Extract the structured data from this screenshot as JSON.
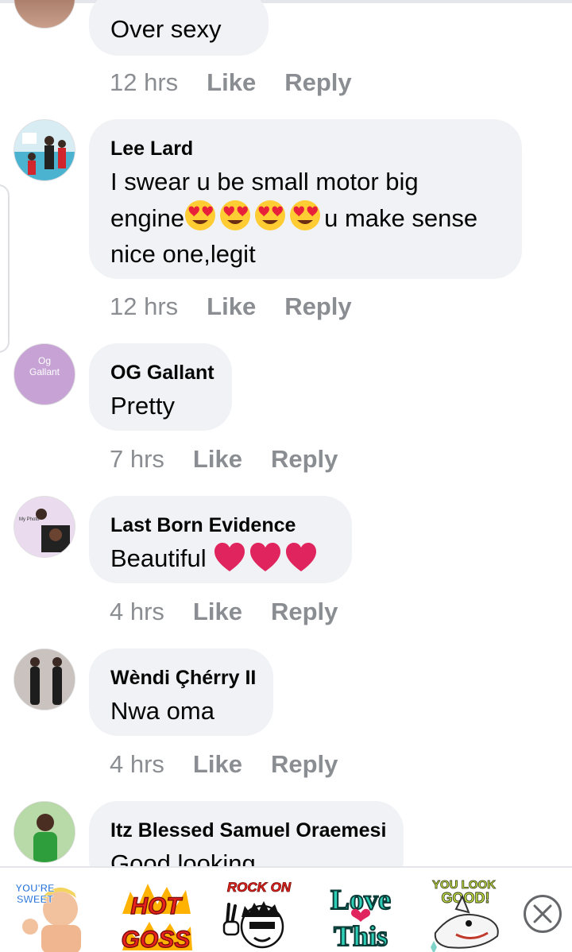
{
  "comments": [
    {
      "author": "",
      "text": "Over sexy",
      "time": "12 hrs",
      "like": "Like",
      "reply": "Reply"
    },
    {
      "author": "Lee Lard",
      "text_line1": "I swear u be small motor big",
      "text_line2_start": "engine",
      "text_line2_end": "u make sense",
      "text_line3": "nice one,legit",
      "time": "12 hrs",
      "like": "Like",
      "reply": "Reply"
    },
    {
      "author": "OG Gallant",
      "avatar_text_1": "Og",
      "avatar_text_2": "Gallant",
      "text": "Pretty",
      "time": "7 hrs",
      "like": "Like",
      "reply": "Reply"
    },
    {
      "author": "Last Born Evidence",
      "avatar_caption": "My Photo",
      "text": "Beautiful",
      "time": "4 hrs",
      "like": "Like",
      "reply": "Reply"
    },
    {
      "author": "Wèndi Çhérry II",
      "text": "Nwa oma",
      "time": "4 hrs",
      "like": "Like",
      "reply": "Reply"
    },
    {
      "author": "Itz Blessed Samuel Oraemesi",
      "text": "Good looking"
    }
  ],
  "stickers": [
    {
      "name": "youre-sweet",
      "line1": "YOU'RE",
      "line2": "SWEET"
    },
    {
      "name": "hot-goss",
      "line1": "HOT",
      "line2": "GOSS"
    },
    {
      "name": "rock-on",
      "line1": "ROCK ON"
    },
    {
      "name": "love-this",
      "line1": "Love",
      "line2": "This"
    },
    {
      "name": "you-look-good",
      "line1": "YOU LOOK",
      "line2": "GOOD!"
    }
  ],
  "colors": {
    "bubble": "#f0f2f5",
    "meta": "#8a8d91",
    "heart": "#e0245e",
    "emoji_face": "#ffcc33"
  },
  "icons": [
    "heart-eyes-emoji-icon",
    "red-heart-icon",
    "close-icon"
  ]
}
